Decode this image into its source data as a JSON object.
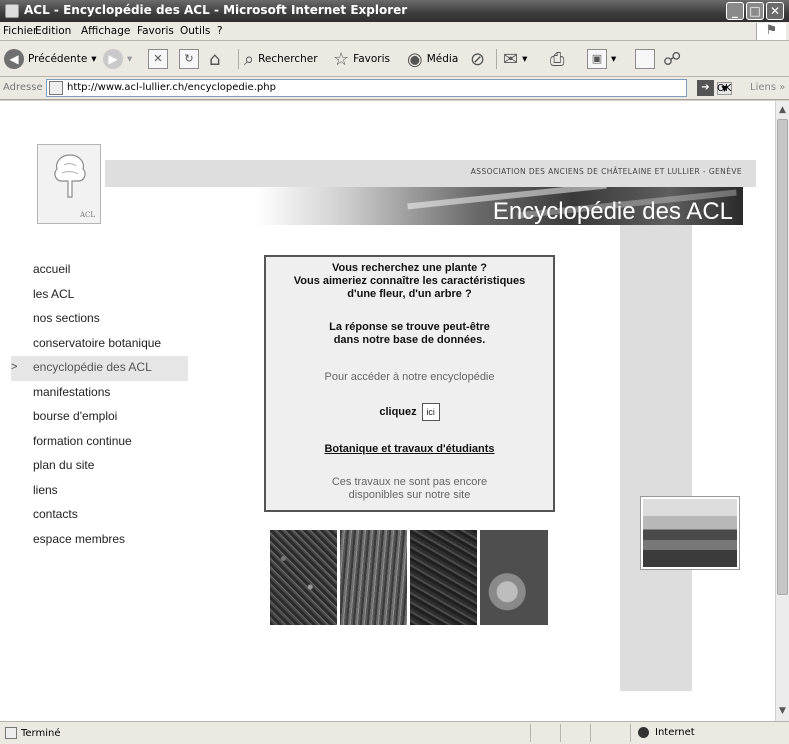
{
  "window": {
    "title": "ACL - Encyclopédie des ACL - Microsoft Internet Explorer",
    "controls": {
      "minimize": "_",
      "maximize": "□",
      "close": "✕"
    }
  },
  "menu": [
    "Fichier",
    "Edition",
    "Affichage",
    "Favoris",
    "Outils",
    "?"
  ],
  "toolbar": {
    "back_label": "Précédente",
    "search_label": "Rechercher",
    "favorites_label": "Favoris",
    "media_label": "Média"
  },
  "address": {
    "label": "Adresse",
    "url": "http://www.acl-lullier.ch/encyclopedie.php",
    "go_label": "OK",
    "links_label": "Liens"
  },
  "site": {
    "logo_text": "ACL",
    "association": "ASSOCIATION DES ANCIENS DE CHÂTELAINE ET LULLIER - GENÈVE",
    "banner_title": "Encyclopédie des ACL",
    "nav": [
      {
        "label": "accueil",
        "active": false
      },
      {
        "label": "les ACL",
        "active": false
      },
      {
        "label": "nos sections",
        "active": false
      },
      {
        "label": "conservatoire botanique",
        "active": false
      },
      {
        "label": "encyclopédie des ACL",
        "active": true
      },
      {
        "label": "manifestations",
        "active": false
      },
      {
        "label": "bourse d'emploi",
        "active": false
      },
      {
        "label": "formation continue",
        "active": false
      },
      {
        "label": "plan du site",
        "active": false
      },
      {
        "label": "liens",
        "active": false
      },
      {
        "label": "contacts",
        "active": false
      },
      {
        "label": "espace membres",
        "active": false
      }
    ],
    "active_marker": ">",
    "box": {
      "q1_line1": "Vous recherchez une plante ?",
      "q1_line2": "Vous aimeriez connaître les caractéristiques",
      "q1_line3": "d'une fleur, d'un arbre ?",
      "answer_line1": "La réponse se trouve peut-être",
      "answer_line2": "dans notre base de données.",
      "access_text": "Pour accéder à notre encyclopédie",
      "click_label": "cliquez",
      "ici_label": "ici",
      "link_text": "Botanique et travaux d'étudiants",
      "note_line1": "Ces travaux ne sont pas encore",
      "note_line2": "disponibles sur notre site"
    }
  },
  "status": {
    "text": "Terminé",
    "zone": "Internet"
  }
}
